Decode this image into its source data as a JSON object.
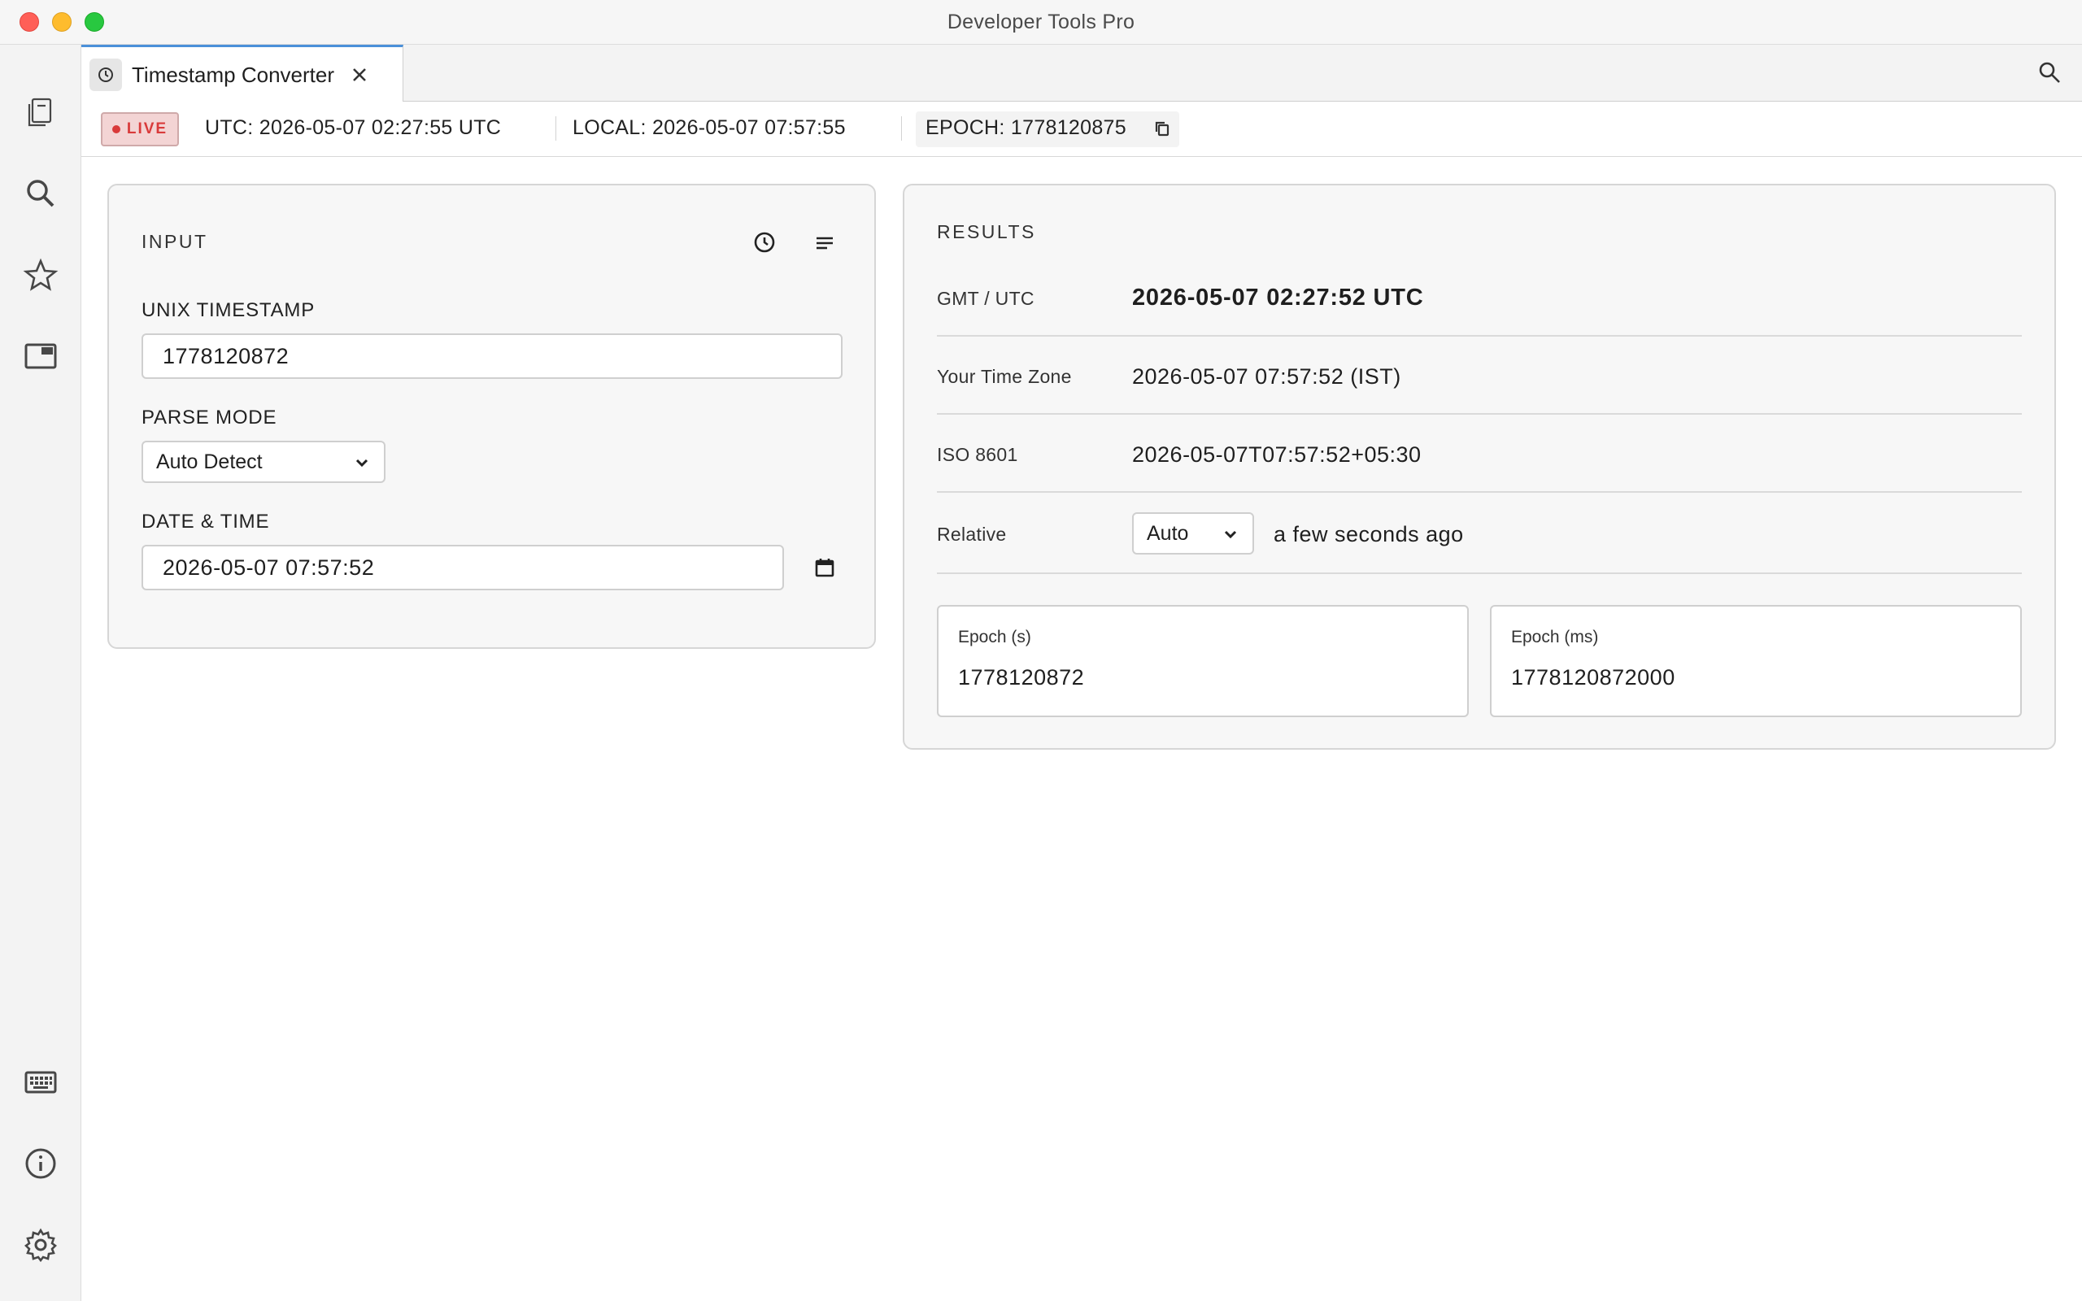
{
  "window": {
    "title": "Developer Tools Pro"
  },
  "tab": {
    "label": "Timestamp Converter",
    "icon": "clock-icon"
  },
  "activity_bar": {
    "top_icons": [
      "files-icon",
      "search-icon",
      "star-icon",
      "window-icon"
    ],
    "bottom_icons": [
      "keyboard-icon",
      "info-icon",
      "gear-icon"
    ]
  },
  "status": {
    "live_label": "LIVE",
    "utc_key": "UTC:",
    "utc_value": "2026-05-07 02:27:55 UTC",
    "local_key": "LOCAL:",
    "local_value": "2026-05-07 07:57:55",
    "epoch_key": "EPOCH:",
    "epoch_value": "1778120875"
  },
  "input": {
    "heading": "INPUT",
    "unix_label": "UNIX TIMESTAMP",
    "unix_value": "1778120872",
    "parse_label": "PARSE MODE",
    "parse_value": "Auto Detect",
    "datetime_label": "DATE & TIME",
    "datetime_value": "2026-05-07 07:57:52"
  },
  "results": {
    "heading": "RESULTS",
    "rows": [
      {
        "key": "GMT / UTC",
        "value": "2026-05-07 02:27:52 UTC"
      },
      {
        "key": "Your Time Zone",
        "value": "2026-05-07 07:57:52 (IST)"
      },
      {
        "key": "ISO 8601",
        "value": "2026-05-07T07:57:52+05:30"
      },
      {
        "key": "Relative",
        "select": "Auto",
        "value": "a few seconds ago"
      }
    ],
    "epoch_s_label": "Epoch (s)",
    "epoch_s_value": "1778120872",
    "epoch_ms_label": "Epoch (ms)",
    "epoch_ms_value": "1778120872000"
  },
  "colors": {
    "accent": "#4a90d9",
    "live": "#d93a3a",
    "live_bg": "#f3d4d4"
  }
}
